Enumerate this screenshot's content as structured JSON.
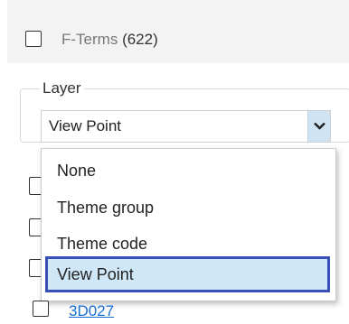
{
  "fterms": {
    "label": "F-Terms",
    "count": "(622)"
  },
  "layer": {
    "legend": "Layer",
    "selected_value": "View Point",
    "options": [
      "None",
      "Theme group",
      "Theme code",
      "View Point"
    ]
  },
  "list": {
    "link_text": "3D027"
  },
  "icons": {
    "dropdown_arrow": "chevron-down-icon"
  },
  "colors": {
    "accent_border": "#3a4fb5",
    "selection_bg": "#cfe7f7",
    "link": "#1a6fd1"
  }
}
